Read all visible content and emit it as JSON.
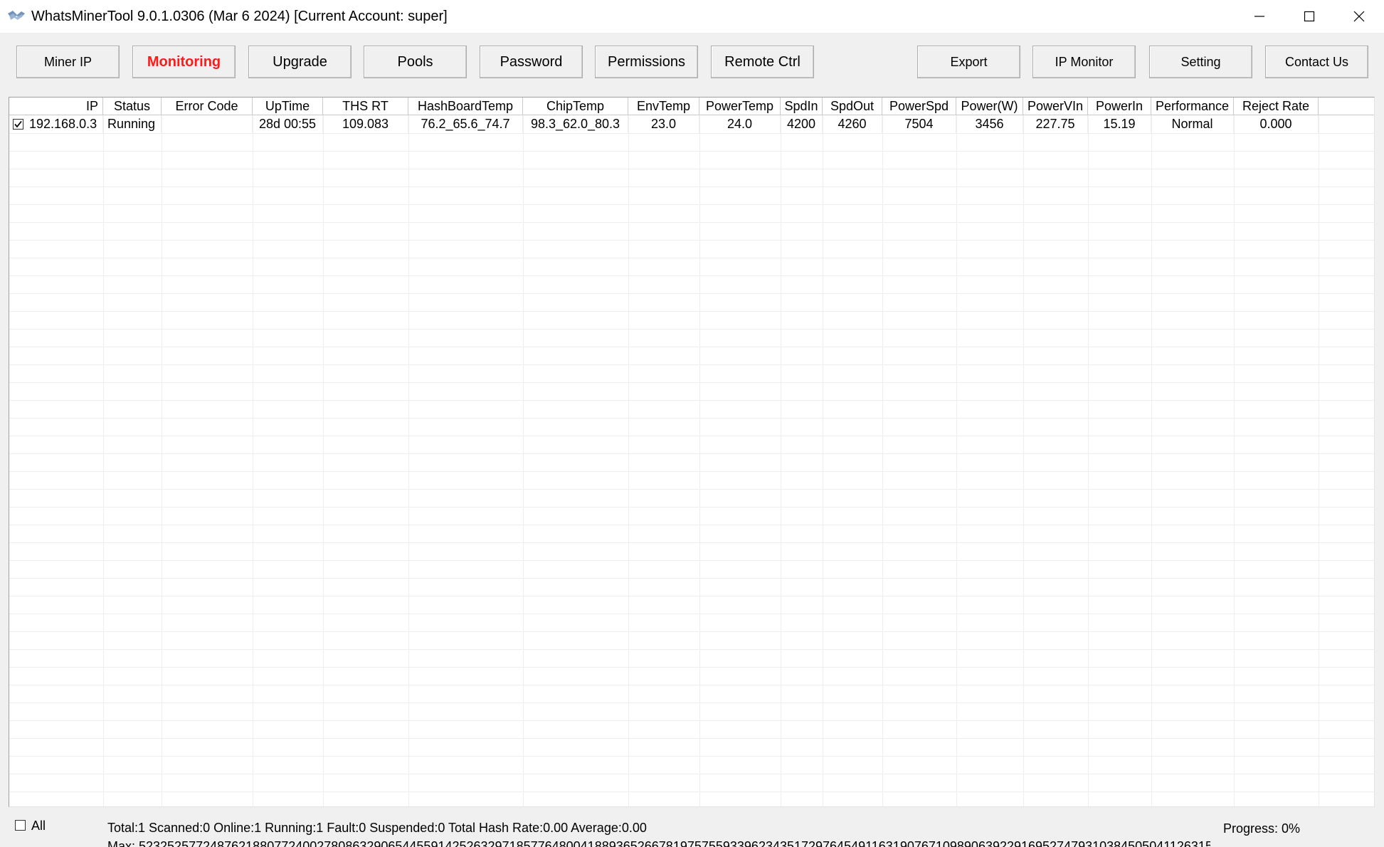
{
  "window": {
    "title": "WhatsMinerTool 9.0.1.0306 (Mar  6 2024) [Current Account: super]"
  },
  "toolbar": {
    "buttons": [
      {
        "id": "miner-ip",
        "label": "Miner IP"
      },
      {
        "id": "monitoring",
        "label": "Monitoring",
        "active": true
      },
      {
        "id": "upgrade",
        "label": "Upgrade"
      },
      {
        "id": "pools",
        "label": "Pools"
      },
      {
        "id": "password",
        "label": "Password"
      },
      {
        "id": "permissions",
        "label": "Permissions"
      },
      {
        "id": "remote-ctrl",
        "label": "Remote Ctrl"
      },
      {
        "id": "export",
        "label": "Export"
      },
      {
        "id": "ip-monitor",
        "label": "IP Monitor"
      },
      {
        "id": "setting",
        "label": "Setting"
      },
      {
        "id": "contact-us",
        "label": "Contact Us"
      }
    ],
    "active_color": "#ff1a1a"
  },
  "table": {
    "columns": [
      "IP",
      "Status",
      "Error Code",
      "UpTime",
      "THS RT",
      "HashBoardTemp",
      "ChipTemp",
      "EnvTemp",
      "PowerTemp",
      "SpdIn",
      "SpdOut",
      "PowerSpd",
      "Power(W)",
      "PowerVIn",
      "PowerIn",
      "Performance",
      "Reject Rate"
    ],
    "rows": [
      {
        "checked": true,
        "cells": [
          "192.168.0.3",
          "Running",
          "",
          "28d 00:55",
          "109.083",
          "76.2_65.6_74.7",
          "98.3_62.0_80.3",
          "23.0",
          "24.0",
          "4200",
          "4260",
          "7504",
          "3456",
          "227.75",
          "15.19",
          "Normal",
          "0.000"
        ]
      }
    ]
  },
  "footer": {
    "all_label": "All",
    "all_checked": false,
    "summary": "Total:1  Scanned:0  Online:1  Running:1  Fault:0  Suspended:0  Total Hash Rate:0.00  Average:0.00",
    "mac_line": "Max: 5232525772487621880772400278086329065445591425263297185776480041889365266781975755933962343517297645491163190767109890639229169527479310384505041126315",
    "progress": "Progress: 0%"
  }
}
